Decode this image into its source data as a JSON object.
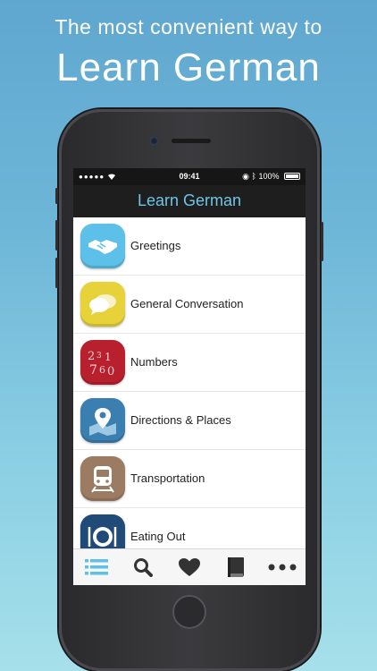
{
  "promo": {
    "subtitle": "The most convenient way to",
    "title": "Learn German"
  },
  "status_bar": {
    "signal": "●●●●●",
    "time": "09:41",
    "battery": "100%"
  },
  "nav": {
    "title": "Learn German"
  },
  "categories": [
    {
      "label": "Greetings",
      "icon": "handshake-icon",
      "color": "#5cc0e8"
    },
    {
      "label": "General Conversation",
      "icon": "speech-bubbles-icon",
      "color": "#e8d23a"
    },
    {
      "label": "Numbers",
      "icon": "numbers-icon",
      "color": "#b8202e"
    },
    {
      "label": "Directions & Places",
      "icon": "map-pin-icon",
      "color": "#3b7fb0"
    },
    {
      "label": "Transportation",
      "icon": "train-icon",
      "color": "#9b7c62"
    },
    {
      "label": "Eating Out",
      "icon": "plate-icon",
      "color": "#204a78"
    }
  ],
  "tabbar": {
    "items": [
      "list-icon",
      "search-icon",
      "heart-icon",
      "book-icon",
      "more-icon"
    ],
    "active_color": "#5cc0e8",
    "color": "#333333"
  }
}
